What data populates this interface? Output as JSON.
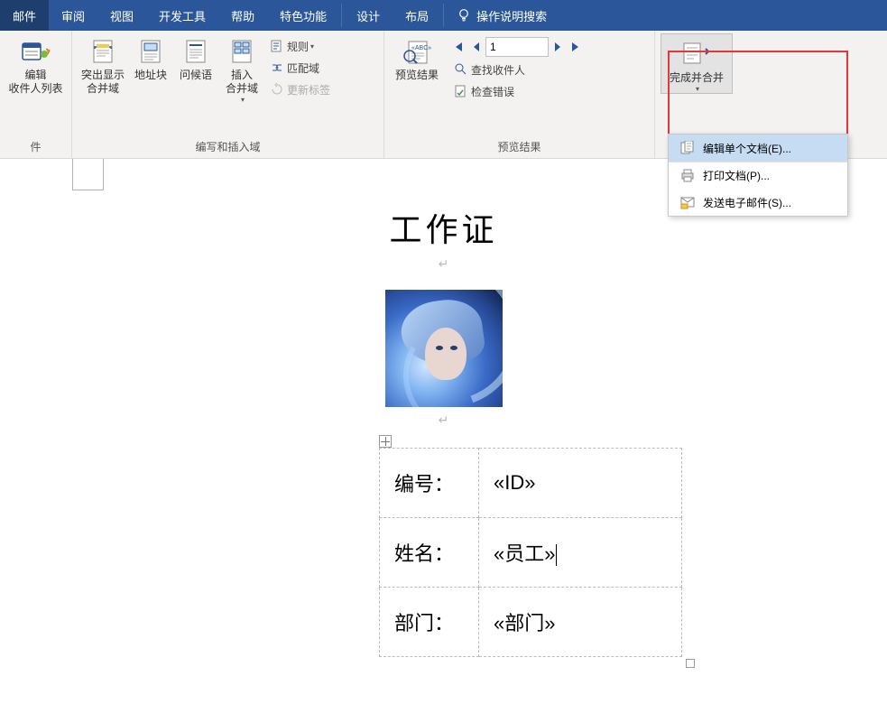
{
  "tabs": {
    "mailings": "邮件",
    "review": "审阅",
    "view": "视图",
    "developer": "开发工具",
    "help": "帮助",
    "special": "特色功能",
    "design": "设计",
    "layout": "布局"
  },
  "tell_me": "操作说明搜索",
  "groups": {
    "start_group": "件",
    "write_insert": "编写和插入域",
    "preview_group": "预览结果"
  },
  "big_buttons": {
    "edit_recipients": "编辑\n收件人列表",
    "highlight_field": "突出显示\n合并域",
    "address_block": "地址块",
    "greeting_line": "问候语",
    "insert_field": "插入\n合并域",
    "preview_results": "预览结果",
    "finish_merge": "完成并合并"
  },
  "small_buttons": {
    "rules": "规则",
    "match_fields": "匹配域",
    "update_labels": "更新标签",
    "find_recipient": "查找收件人",
    "check_errors": "检查错误"
  },
  "record_nav": {
    "value": "1"
  },
  "finish_menu": {
    "edit_individual": "编辑单个文档(E)...",
    "print": "打印文档(P)...",
    "email": "发送电子邮件(S)..."
  },
  "document": {
    "title": "工作证",
    "table": {
      "row1_label": "编号：",
      "row1_value": "«ID»",
      "row2_label": "姓名：",
      "row2_value": "«员工»",
      "row3_label": "部门：",
      "row3_value": "«部门»"
    }
  }
}
